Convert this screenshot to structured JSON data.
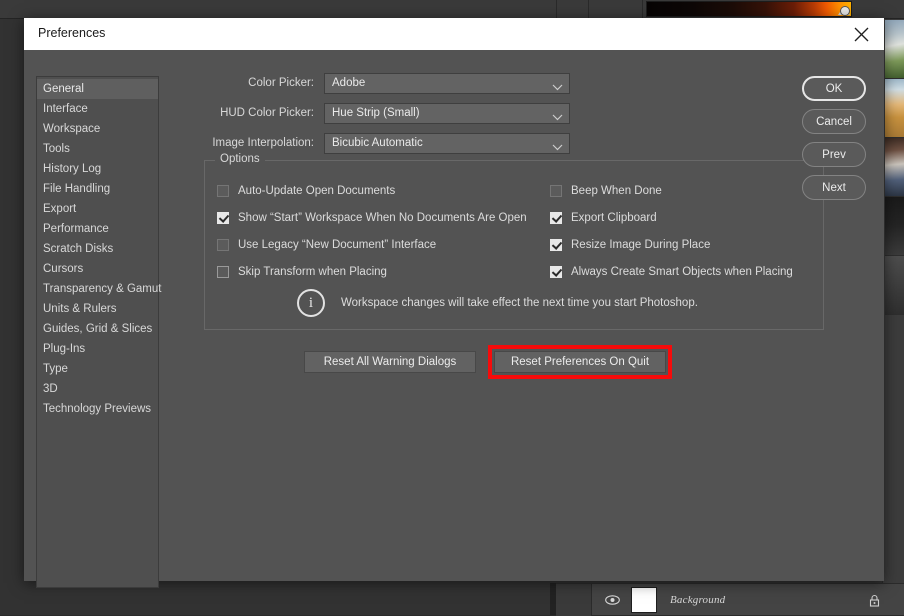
{
  "app": {
    "layers_panel": {
      "layer_name": "Background",
      "eye_icon": "eye-icon",
      "lock_icon": "lock-icon"
    }
  },
  "dialog": {
    "title": "Preferences",
    "close_icon": "close-icon",
    "sidebar": {
      "items": [
        {
          "label": "General",
          "selected": true
        },
        {
          "label": "Interface",
          "selected": false
        },
        {
          "label": "Workspace",
          "selected": false
        },
        {
          "label": "Tools",
          "selected": false
        },
        {
          "label": "History Log",
          "selected": false
        },
        {
          "label": "File Handling",
          "selected": false
        },
        {
          "label": "Export",
          "selected": false
        },
        {
          "label": "Performance",
          "selected": false
        },
        {
          "label": "Scratch Disks",
          "selected": false
        },
        {
          "label": "Cursors",
          "selected": false
        },
        {
          "label": "Transparency & Gamut",
          "selected": false
        },
        {
          "label": "Units & Rulers",
          "selected": false
        },
        {
          "label": "Guides, Grid & Slices",
          "selected": false
        },
        {
          "label": "Plug-Ins",
          "selected": false
        },
        {
          "label": "Type",
          "selected": false
        },
        {
          "label": "3D",
          "selected": false
        },
        {
          "label": "Technology Previews",
          "selected": false
        }
      ]
    },
    "fields": [
      {
        "label": "Color Picker:",
        "value": "Adobe"
      },
      {
        "label": "HUD Color Picker:",
        "value": "Hue Strip (Small)"
      },
      {
        "label": "Image Interpolation:",
        "value": "Bicubic Automatic"
      }
    ],
    "options_group": {
      "title": "Options",
      "left_column": [
        {
          "label": "Auto-Update Open Documents",
          "checked": false
        },
        {
          "label": "Show “Start” Workspace When No Documents Are Open",
          "checked": true
        },
        {
          "label": "Use Legacy “New Document” Interface",
          "checked": false
        },
        {
          "label": "Skip Transform when Placing",
          "checked": false
        }
      ],
      "right_column": [
        {
          "label": "Beep When Done",
          "checked": false
        },
        {
          "label": "Export Clipboard",
          "checked": true
        },
        {
          "label": "Resize Image During Place",
          "checked": true
        },
        {
          "label": "Always Create Smart Objects when Placing",
          "checked": true
        }
      ],
      "info": {
        "icon": "info-icon",
        "text": "Workspace changes will take effect the next time you start Photoshop."
      }
    },
    "reset_buttons": {
      "reset_warnings": "Reset All Warning Dialogs",
      "reset_prefs": "Reset Preferences On Quit"
    },
    "action_buttons": [
      {
        "label": "OK",
        "primary": true
      },
      {
        "label": "Cancel",
        "primary": false
      },
      {
        "label": "Prev",
        "primary": false
      },
      {
        "label": "Next",
        "primary": false
      }
    ]
  },
  "highlight": {
    "color": "#f60b0b",
    "target": "Reset Preferences On Quit"
  }
}
